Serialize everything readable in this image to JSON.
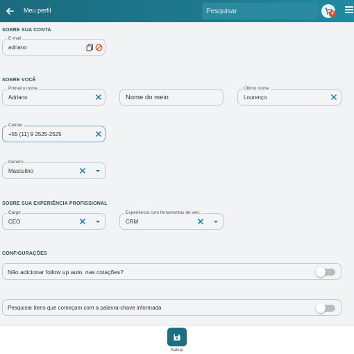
{
  "header": {
    "title": "Meu perfil",
    "search_placeholder": "Pesquisar",
    "cart_count": "0"
  },
  "sections": {
    "account": "SOBRE SUA CONTA",
    "about": "SOBRE VOCÊ",
    "professional": "SOBRE SUA EXPERIÊNCIA PROFISSIONAL",
    "config": "CONFIGURAÇÕES"
  },
  "account": {
    "email_label": "E-mail",
    "email_value": "adriano"
  },
  "about": {
    "first_name_label": "Primeiro nome",
    "first_name_value": "Adriano",
    "middle_name_placeholder": "Nome do meio",
    "last_name_label": "Último nome",
    "last_name_value": "Lourenço",
    "phone_label": "Celular",
    "phone_value": "+55 (11) 9 2525-2525",
    "gender_label": "Genero",
    "gender_value": "Masculino"
  },
  "professional": {
    "role_label": "Cargo",
    "role_value": "CEO",
    "tools_label": "Experiência com ferramentas de ven...",
    "tools_value": "CRM"
  },
  "config": {
    "toggle1_label": "Não adicionar follow up auto. nas cotações?",
    "toggle1_on": false,
    "toggle2_label": "Pesquisar itens que começam com a palavra-chave informada",
    "toggle2_on": false
  },
  "footer": {
    "save_label": "Salvar"
  },
  "colors": {
    "header": "#1e7a8e",
    "accent": "#0e7fa0",
    "danger": "#e04c2b"
  }
}
